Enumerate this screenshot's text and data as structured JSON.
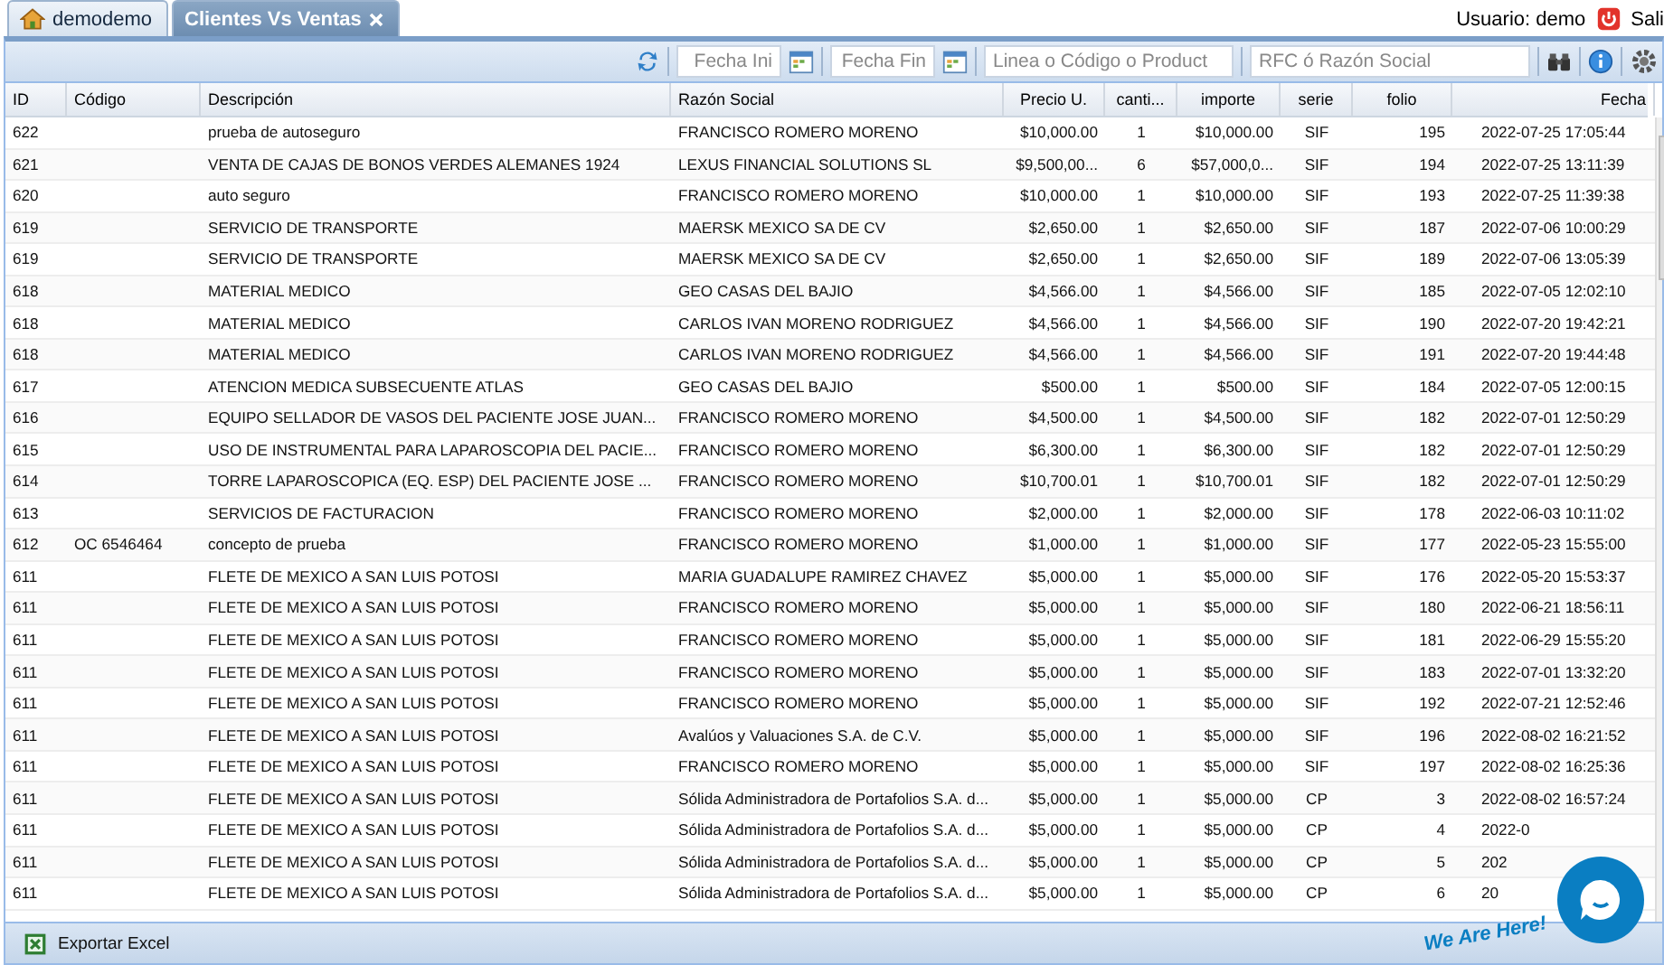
{
  "tabs": [
    {
      "label": "demodemo",
      "kind": "home",
      "selected": false
    },
    {
      "label": "Clientes Vs Ventas",
      "kind": "closable",
      "selected": true
    }
  ],
  "user": {
    "label": "Usuario: demo",
    "logout": "Sali"
  },
  "toolbar": {
    "fecha_ini": {
      "placeholder": "Fecha Ini"
    },
    "fecha_fin": {
      "placeholder": "Fecha Fin"
    },
    "producto": {
      "placeholder": "Linea o Código o Product"
    },
    "cliente": {
      "placeholder": "RFC ó Razón Social"
    }
  },
  "table": {
    "columns": [
      "ID",
      "Código",
      "Descripción",
      "Razón Social",
      "Precio U.",
      "canti...",
      "importe",
      "serie",
      "folio",
      "Fecha"
    ],
    "rows": [
      [
        "622",
        "",
        "prueba de autoseguro",
        "FRANCISCO ROMERO MORENO",
        "$10,000.00",
        "1",
        "$10,000.00",
        "SIF",
        "195",
        "2022-07-25 17:05:44"
      ],
      [
        "621",
        "",
        "VENTA DE CAJAS DE BONOS VERDES ALEMANES 1924",
        "LEXUS FINANCIAL SOLUTIONS SL",
        "$9,500,00...",
        "6",
        "$57,000,0...",
        "SIF",
        "194",
        "2022-07-25 13:11:39"
      ],
      [
        "620",
        "",
        "auto seguro",
        "FRANCISCO ROMERO MORENO",
        "$10,000.00",
        "1",
        "$10,000.00",
        "SIF",
        "193",
        "2022-07-25 11:39:38"
      ],
      [
        "619",
        "",
        "SERVICIO DE TRANSPORTE",
        "MAERSK MEXICO SA DE CV",
        "$2,650.00",
        "1",
        "$2,650.00",
        "SIF",
        "187",
        "2022-07-06 10:00:29"
      ],
      [
        "619",
        "",
        "SERVICIO DE TRANSPORTE",
        "MAERSK MEXICO SA DE CV",
        "$2,650.00",
        "1",
        "$2,650.00",
        "SIF",
        "189",
        "2022-07-06 13:05:39"
      ],
      [
        "618",
        "",
        "MATERIAL MEDICO",
        "GEO CASAS DEL BAJIO",
        "$4,566.00",
        "1",
        "$4,566.00",
        "SIF",
        "185",
        "2022-07-05 12:02:10"
      ],
      [
        "618",
        "",
        "MATERIAL MEDICO",
        "CARLOS IVAN MORENO RODRIGUEZ",
        "$4,566.00",
        "1",
        "$4,566.00",
        "SIF",
        "190",
        "2022-07-20 19:42:21"
      ],
      [
        "618",
        "",
        "MATERIAL MEDICO",
        "CARLOS IVAN MORENO RODRIGUEZ",
        "$4,566.00",
        "1",
        "$4,566.00",
        "SIF",
        "191",
        "2022-07-20 19:44:48"
      ],
      [
        "617",
        "",
        "ATENCION MEDICA SUBSECUENTE ATLAS",
        "GEO CASAS DEL BAJIO",
        "$500.00",
        "1",
        "$500.00",
        "SIF",
        "184",
        "2022-07-05 12:00:15"
      ],
      [
        "616",
        "",
        "EQUIPO SELLADOR DE VASOS DEL PACIENTE JOSE JUAN...",
        "FRANCISCO ROMERO MORENO",
        "$4,500.00",
        "1",
        "$4,500.00",
        "SIF",
        "182",
        "2022-07-01 12:50:29"
      ],
      [
        "615",
        "",
        "USO DE INSTRUMENTAL PARA LAPAROSCOPIA DEL PACIE...",
        "FRANCISCO ROMERO MORENO",
        "$6,300.00",
        "1",
        "$6,300.00",
        "SIF",
        "182",
        "2022-07-01 12:50:29"
      ],
      [
        "614",
        "",
        "TORRE LAPAROSCOPICA (EQ. ESP) DEL PACIENTE JOSE ...",
        "FRANCISCO ROMERO MORENO",
        "$10,700.01",
        "1",
        "$10,700.01",
        "SIF",
        "182",
        "2022-07-01 12:50:29"
      ],
      [
        "613",
        "",
        "SERVICIOS DE FACTURACION",
        "FRANCISCO ROMERO MORENO",
        "$2,000.00",
        "1",
        "$2,000.00",
        "SIF",
        "178",
        "2022-06-03 10:11:02"
      ],
      [
        "612",
        "OC 6546464",
        "concepto de prueba",
        "FRANCISCO ROMERO MORENO",
        "$1,000.00",
        "1",
        "$1,000.00",
        "SIF",
        "177",
        "2022-05-23 15:55:00"
      ],
      [
        "611",
        "",
        "FLETE DE MEXICO A SAN LUIS POTOSI",
        "MARIA GUADALUPE RAMIREZ CHAVEZ",
        "$5,000.00",
        "1",
        "$5,000.00",
        "SIF",
        "176",
        "2022-05-20 15:53:37"
      ],
      [
        "611",
        "",
        "FLETE DE MEXICO A SAN LUIS POTOSI",
        "FRANCISCO ROMERO MORENO",
        "$5,000.00",
        "1",
        "$5,000.00",
        "SIF",
        "180",
        "2022-06-21 18:56:11"
      ],
      [
        "611",
        "",
        "FLETE DE MEXICO A SAN LUIS POTOSI",
        "FRANCISCO ROMERO MORENO",
        "$5,000.00",
        "1",
        "$5,000.00",
        "SIF",
        "181",
        "2022-06-29 15:55:20"
      ],
      [
        "611",
        "",
        "FLETE DE MEXICO A SAN LUIS POTOSI",
        "FRANCISCO ROMERO MORENO",
        "$5,000.00",
        "1",
        "$5,000.00",
        "SIF",
        "183",
        "2022-07-01 13:32:20"
      ],
      [
        "611",
        "",
        "FLETE DE MEXICO A SAN LUIS POTOSI",
        "FRANCISCO ROMERO MORENO",
        "$5,000.00",
        "1",
        "$5,000.00",
        "SIF",
        "192",
        "2022-07-21 12:52:46"
      ],
      [
        "611",
        "",
        "FLETE DE MEXICO A SAN LUIS POTOSI",
        "Avalúos y Valuaciones S.A. de C.V.",
        "$5,000.00",
        "1",
        "$5,000.00",
        "SIF",
        "196",
        "2022-08-02 16:21:52"
      ],
      [
        "611",
        "",
        "FLETE DE MEXICO A SAN LUIS POTOSI",
        "FRANCISCO ROMERO MORENO",
        "$5,000.00",
        "1",
        "$5,000.00",
        "SIF",
        "197",
        "2022-08-02 16:25:36"
      ],
      [
        "611",
        "",
        "FLETE DE MEXICO A SAN LUIS POTOSI",
        "Sólida Administradora de Portafolios S.A. d...",
        "$5,000.00",
        "1",
        "$5,000.00",
        "CP",
        "3",
        "2022-08-02 16:57:24"
      ],
      [
        "611",
        "",
        "FLETE DE MEXICO A SAN LUIS POTOSI",
        "Sólida Administradora de Portafolios S.A. d...",
        "$5,000.00",
        "1",
        "$5,000.00",
        "CP",
        "4",
        "2022-0"
      ],
      [
        "611",
        "",
        "FLETE DE MEXICO A SAN LUIS POTOSI",
        "Sólida Administradora de Portafolios S.A. d...",
        "$5,000.00",
        "1",
        "$5,000.00",
        "CP",
        "5",
        "202"
      ],
      [
        "611",
        "",
        "FLETE DE MEXICO A SAN LUIS POTOSI",
        "Sólida Administradora de Portafolios S.A. d...",
        "$5,000.00",
        "1",
        "$5,000.00",
        "CP",
        "6",
        "20"
      ]
    ]
  },
  "footer": {
    "export": "Exportar Excel"
  },
  "chat": {
    "label": "We Are Here!"
  }
}
